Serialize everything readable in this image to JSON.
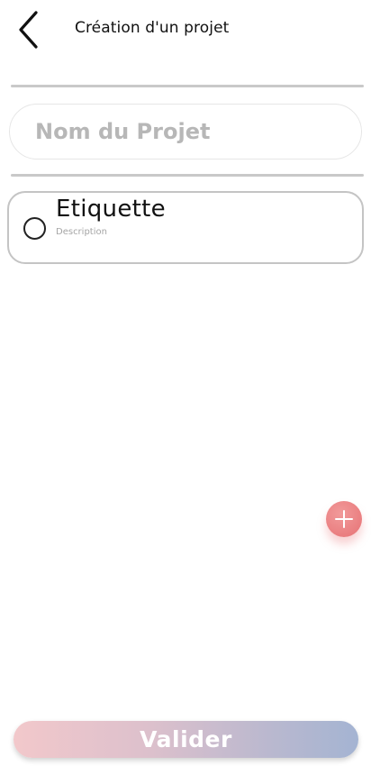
{
  "header": {
    "title": "Création d'un projet",
    "back_icon": "chevron-left-icon"
  },
  "project_form": {
    "name_value": "",
    "name_placeholder": "Nom du Projet"
  },
  "tags": [
    {
      "title": "Etiquette",
      "description": "Description",
      "selected": false
    }
  ],
  "fab": {
    "icon": "plus-icon",
    "color": "#ea7e80"
  },
  "footer": {
    "validate_label": "Valider",
    "gradient_start": "#f2c8cb",
    "gradient_end": "#a4b4d2"
  }
}
